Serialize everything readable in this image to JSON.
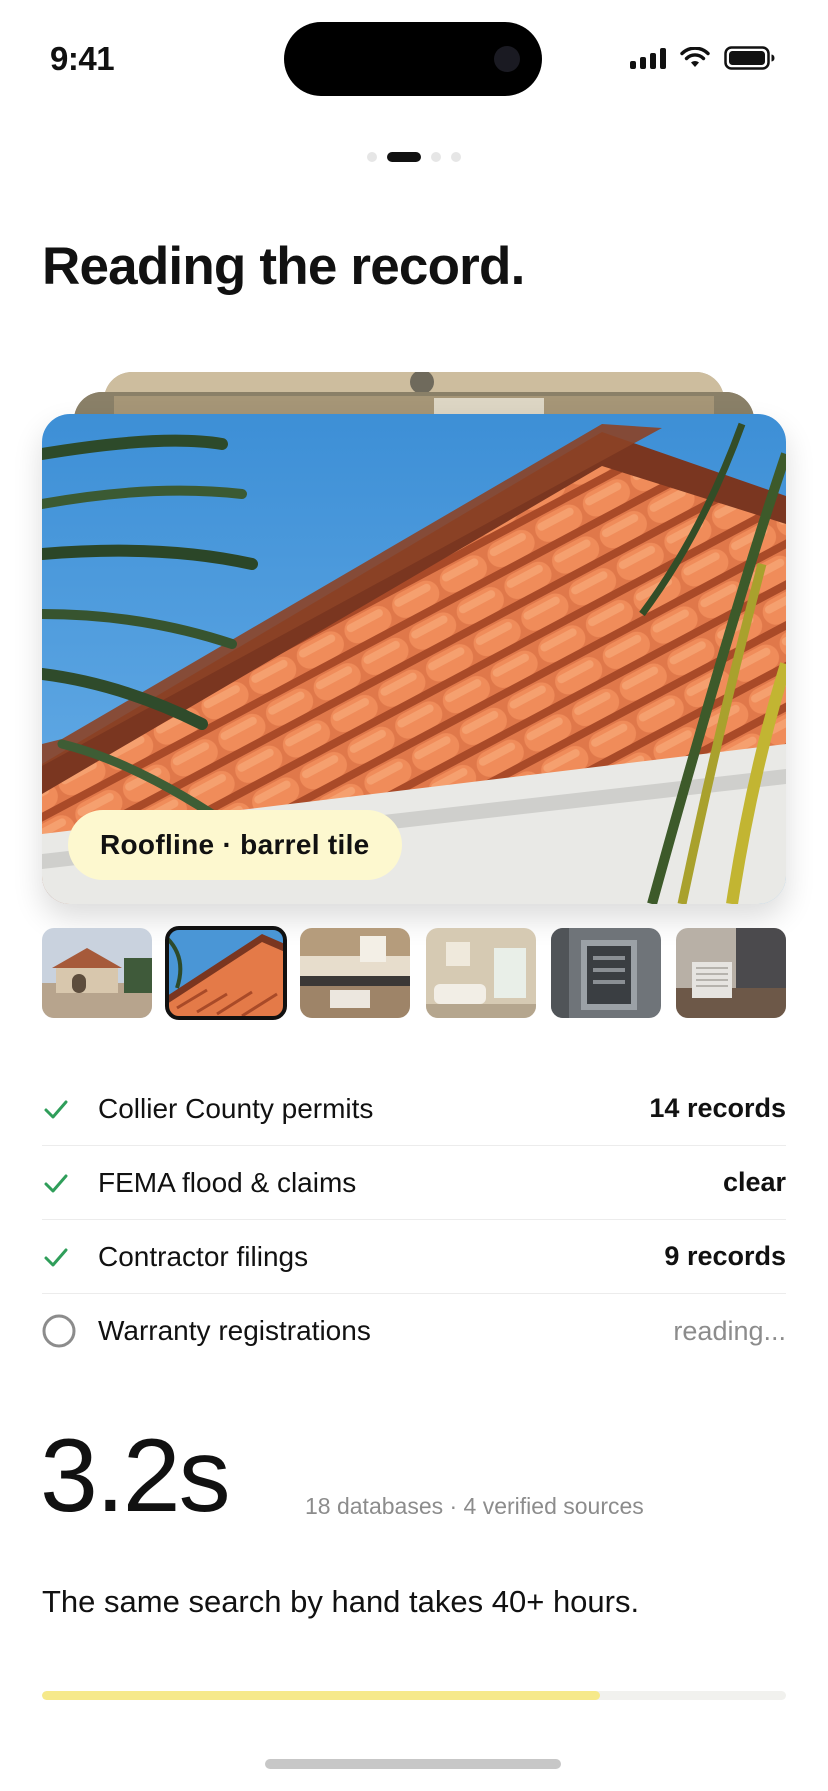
{
  "status_bar": {
    "time": "9:41",
    "icons": [
      "cellular-signal-icon",
      "wifi-icon",
      "battery-icon"
    ]
  },
  "pagination": {
    "total": 4,
    "active_index": 1
  },
  "headline": "Reading the record.",
  "photo_card": {
    "label": "Roofline · barrel tile",
    "label_color": "#fdf8cf",
    "image": "terracotta barrel tile roof with palm fronds against blue sky"
  },
  "thumbnails": [
    {
      "image": "house-exterior"
    },
    {
      "image": "roof-tile",
      "selected": true
    },
    {
      "image": "kitchen"
    },
    {
      "image": "living-room"
    },
    {
      "image": "electrical-panel"
    },
    {
      "image": "ac-unit"
    }
  ],
  "checklist": [
    {
      "label": "Collier County permits",
      "value": "14 records",
      "status": "done"
    },
    {
      "label": "FEMA flood & claims",
      "value": "clear",
      "status": "done"
    },
    {
      "label": "Contractor filings",
      "value": "9 records",
      "status": "done"
    },
    {
      "label": "Warranty registrations",
      "value": "reading...",
      "status": "pending"
    }
  ],
  "stat": {
    "value": "3.2s",
    "subtitle": "18 databases · 4 verified sources"
  },
  "tagline": "The same search by hand takes 40+ hours.",
  "progress": {
    "fraction": 0.75,
    "color": "#f6e98a"
  },
  "colors": {
    "check": "#2f9e5a",
    "pending_ring": "#8c8c8c",
    "text": "#111111"
  }
}
